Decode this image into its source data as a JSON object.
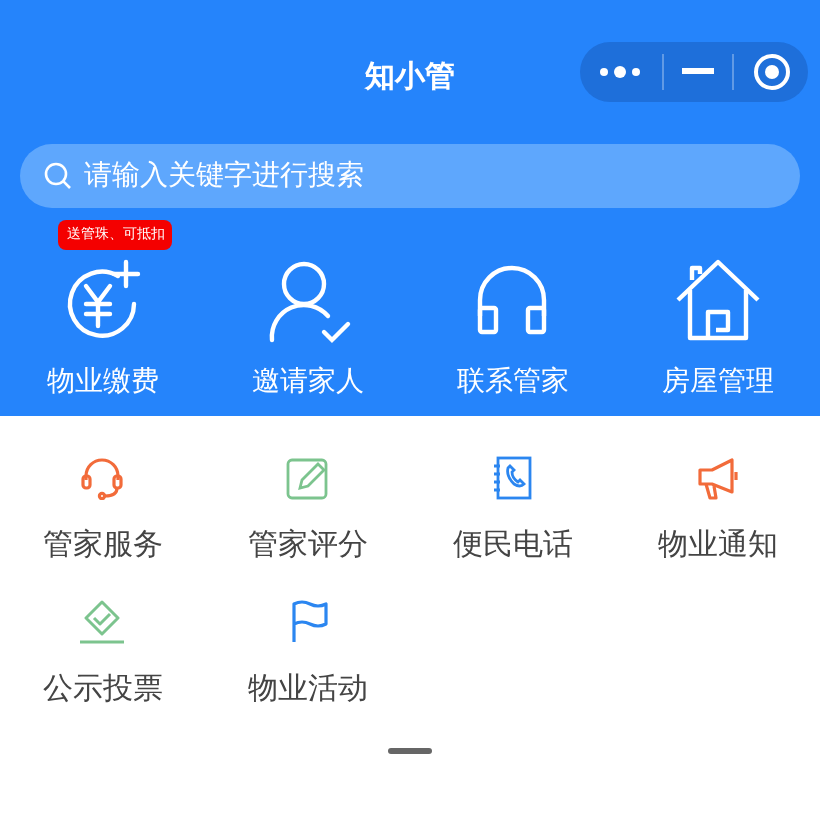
{
  "header": {
    "title": "知小管"
  },
  "search": {
    "placeholder": "请输入关键字进行搜索"
  },
  "main_actions": [
    {
      "label": "物业缴费",
      "kind": "yen",
      "badge": "送管珠、可抵扣"
    },
    {
      "label": "邀请家人",
      "kind": "person"
    },
    {
      "label": "联系管家",
      "kind": "headphones"
    },
    {
      "label": "房屋管理",
      "kind": "house"
    }
  ],
  "services": [
    {
      "label": "管家服务",
      "kind": "headset",
      "color": "#f26b3a"
    },
    {
      "label": "管家评分",
      "kind": "edit",
      "color": "#7cc48e"
    },
    {
      "label": "便民电话",
      "kind": "phonebook",
      "color": "#2b86f0"
    },
    {
      "label": "物业通知",
      "kind": "megaphone",
      "color": "#f26b3a"
    },
    {
      "label": "公示投票",
      "kind": "vote",
      "color": "#7cc48e"
    },
    {
      "label": "物业活动",
      "kind": "flag",
      "color": "#2b86f0"
    }
  ]
}
